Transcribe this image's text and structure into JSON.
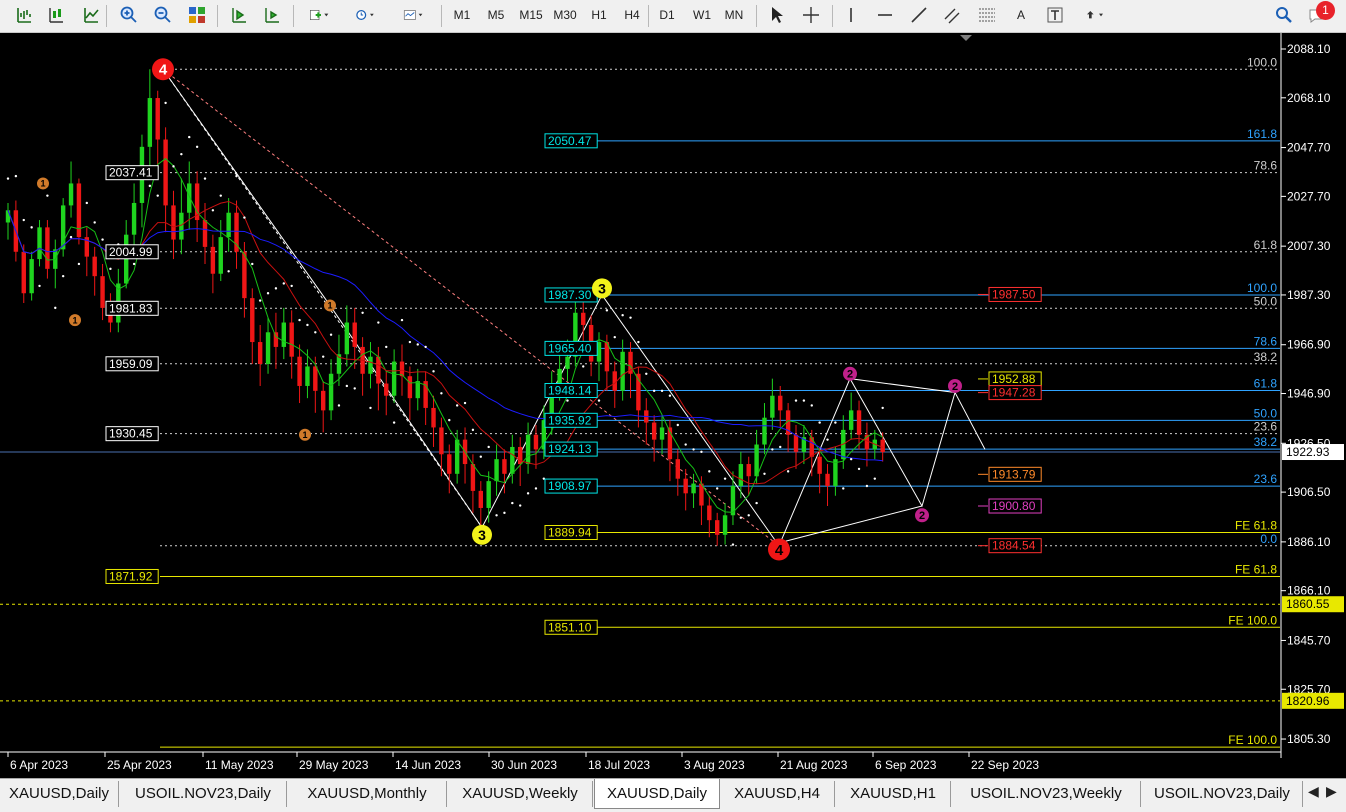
{
  "toolbar": {
    "timeframes": [
      "M1",
      "M5",
      "M15",
      "M30",
      "H1",
      "H4",
      "D1",
      "W1",
      "MN"
    ],
    "text_tool": "A",
    "notification_count": "1"
  },
  "colors": {
    "bull": "#1fd41f",
    "bear": "#f01616",
    "ma_fast": "#16c016",
    "ma_mid": "#c81010",
    "ma_slow": "#1c1cff",
    "fib_blue": "#2fa3ff",
    "level_yellow": "#e8e800",
    "label_cyan": "#00e5e5"
  },
  "chart": {
    "price_axis": [
      "2088.10",
      "2068.10",
      "2047.70",
      "2027.70",
      "2007.30",
      "1987.30",
      "1966.90",
      "1946.90",
      "1926.50",
      "1906.50",
      "1886.10",
      "1866.10",
      "1845.70",
      "1825.70",
      "1805.30"
    ],
    "current_price": "1922.93",
    "dotted_levels": [
      "1860.55",
      "1820.96"
    ],
    "date_axis": [
      "6 Apr 2023",
      "25 Apr 2023",
      "11 May 2023",
      "29 May 2023",
      "14 Jun 2023",
      "30 Jun 2023",
      "18 Jul 2023",
      "3 Aug 2023",
      "21 Aug 2023",
      "6 Sep 2023",
      "22 Sep 2023"
    ],
    "left_level_labels": [
      "2037.41",
      "2004.99",
      "1981.83",
      "1959.09",
      "1930.45",
      "1871.92"
    ],
    "mid_level_labels": [
      "2050.47",
      "1987.30",
      "1965.40",
      "1948.14",
      "1935.92",
      "1924.13",
      "1908.97",
      "1889.94",
      "1851.10"
    ],
    "right_level_labels": [
      {
        "text": "1952.88",
        "color": "yellow"
      },
      {
        "text": "1947.28",
        "color": "red"
      },
      {
        "text": "1987.50",
        "color": "red"
      },
      {
        "text": "1913.79",
        "color": "orange"
      },
      {
        "text": "1900.80",
        "color": "magenta"
      },
      {
        "text": "1884.54",
        "color": "red"
      }
    ],
    "fib_labels": [
      "100.0",
      "161.8",
      "78.6",
      "61.8",
      "100.0",
      "50.0",
      "78.6",
      "38.2",
      "61.8",
      "50.0",
      "23.6",
      "38.2",
      "23.6",
      "FE 61.8",
      "0.0",
      "FE 61.8",
      "FE 100.0",
      "FE 100.0"
    ],
    "wave_labels": [
      "4",
      "1",
      "1",
      "1",
      "1",
      "3",
      "3",
      "4",
      "2",
      "2",
      "2"
    ]
  }
}
